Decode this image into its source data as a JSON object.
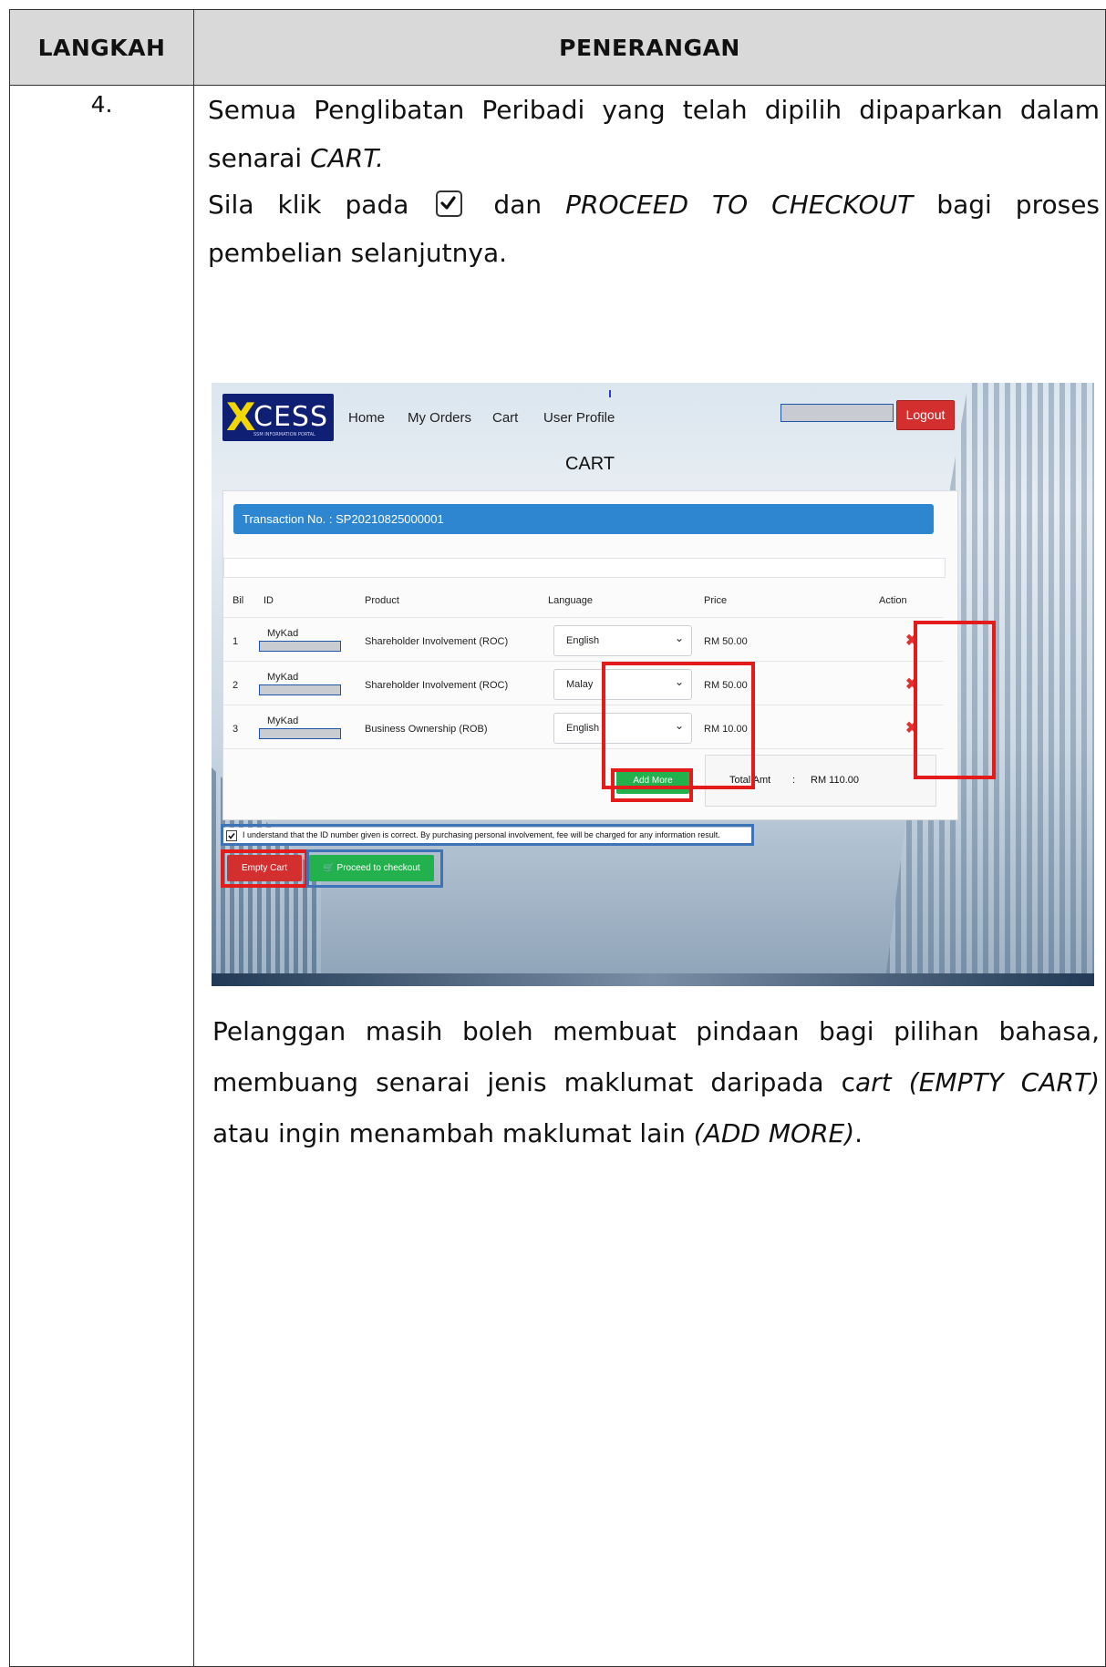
{
  "table": {
    "header_step": "LANGKAH",
    "header_desc": "PENERANGAN",
    "step_number": "4."
  },
  "instructions": {
    "p1_text": "Semua Penglibatan Peribadi yang telah dipilih dipaparkan dalam senarai ",
    "p1_em": "CART.",
    "p2_a": "Sila klik pada ",
    "p2_b": " dan ",
    "p2_em": "PROCEED TO CHECKOUT",
    "p2_c": " bagi proses pembelian selanjutnya.",
    "p3_a": "Pelanggan masih boleh membuat pindaan bagi pilihan bahasa, membuang senarai jenis maklumat daripada c",
    "p3_em1": "art (EMPTY CART)",
    "p3_b": " atau ingin menambah maklumat lain ",
    "p3_em2": "(ADD MORE)",
    "p3_c": "."
  },
  "screenshot": {
    "logo_x": "X",
    "logo_rest": "CESS",
    "logo_sub": "SSM INFORMATION PORTAL",
    "nav": [
      "Home",
      "My Orders",
      "Cart",
      "User Profile"
    ],
    "logout": "Logout",
    "page_title": "CART",
    "transaction": "Transaction No. : SP20210825000001",
    "columns": [
      "Bil",
      "ID",
      "Product",
      "Language",
      "Price",
      "Action"
    ],
    "rows": [
      {
        "bil": "1",
        "id_label": "MyKad",
        "product": "Shareholder Involvement (ROC)",
        "language": "English",
        "price": "RM 50.00"
      },
      {
        "bil": "2",
        "id_label": "MyKad",
        "product": "Shareholder Involvement (ROC)",
        "language": "Malay",
        "price": "RM 50.00"
      },
      {
        "bil": "3",
        "id_label": "MyKad",
        "product": "Business Ownership (ROB)",
        "language": "English",
        "price": "RM 10.00"
      }
    ],
    "add_more": "Add More",
    "total_label": "Total Amt",
    "total_sep": ":",
    "total_value": "RM 110.00",
    "agree_text": "I understand that the ID number given is correct. By purchasing personal involvement, fee will be charged for any information result.",
    "empty_cart": "Empty Cart",
    "checkout": "Proceed to checkout",
    "colors": {
      "primary_blue": "#2d86cf",
      "red": "#d32f2f",
      "green": "#22b14c",
      "highlight_red": "#e31b1b",
      "highlight_blue": "#3e73b8"
    },
    "icons": [
      "delete-x-icon",
      "cart-icon",
      "chevron-down-icon",
      "checkbox-checked-icon"
    ]
  }
}
